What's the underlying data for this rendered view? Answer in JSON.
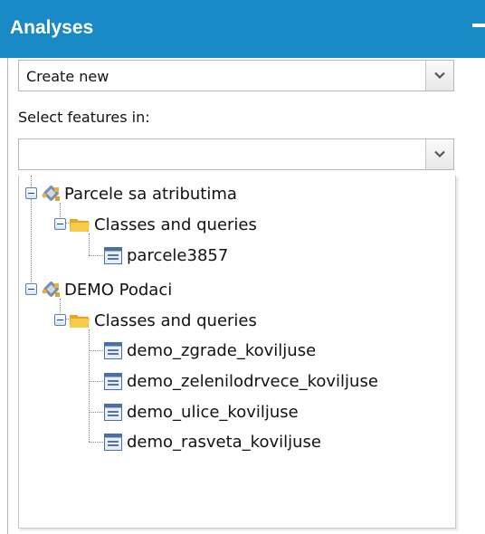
{
  "panel": {
    "title": "Analyses"
  },
  "analysis_select": {
    "value": "Create new"
  },
  "features_label": "Select features in:",
  "features_select": {
    "value": ""
  },
  "tree": {
    "nodes": [
      {
        "label": "Parcele sa atributima"
      },
      {
        "label": "Classes and queries"
      },
      {
        "label": "parcele3857"
      },
      {
        "label": "DEMO Podaci"
      },
      {
        "label": "Classes and queries"
      },
      {
        "label": "demo_zgrade_koviljuse"
      },
      {
        "label": "demo_zelenilodrvece_koviljuse"
      },
      {
        "label": "demo_ulice_koviljuse"
      },
      {
        "label": "demo_rasveta_koviljuse"
      }
    ]
  },
  "colors": {
    "header": "#1a8ac7",
    "folder": "#f6cb4a"
  },
  "icons": {
    "collapse": "minus-icon",
    "dropdown": "chevron-down-icon",
    "service": "service-icon",
    "folder": "folder-icon",
    "layer": "layer-icon",
    "toggle": "minus-box-icon"
  }
}
